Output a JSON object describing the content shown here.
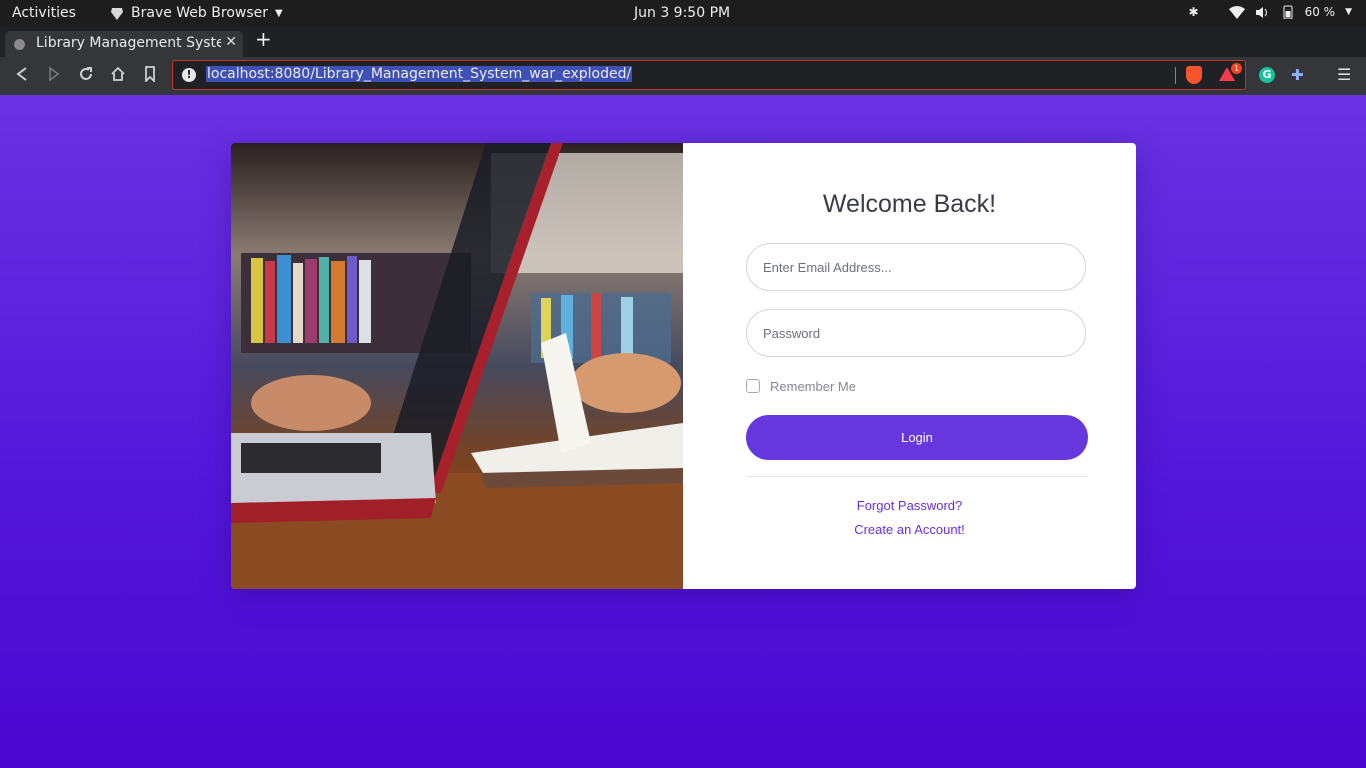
{
  "system_bar": {
    "activities": "Activities",
    "app_name": "Brave Web Browser",
    "clock": "Jun 3   9:50 PM",
    "battery": "60 %"
  },
  "browser": {
    "tab_title": "Library Management Syste",
    "tab_close": "✕",
    "new_tab": "+",
    "url": "localhost:8080/Library_Management_System_war_exploded/",
    "notification_count": "1",
    "extension_g": "G"
  },
  "login_card": {
    "heading": "Welcome Back!",
    "email_placeholder": "Enter Email Address...",
    "password_placeholder": "Password",
    "remember_label": "Remember Me",
    "login_label": "Login",
    "forgot_link": "Forgot Password?",
    "create_link": "Create an Account!"
  },
  "colors": {
    "page_background": "#5a1fdc",
    "accent": "#6537dc",
    "link": "#6a30d8"
  }
}
